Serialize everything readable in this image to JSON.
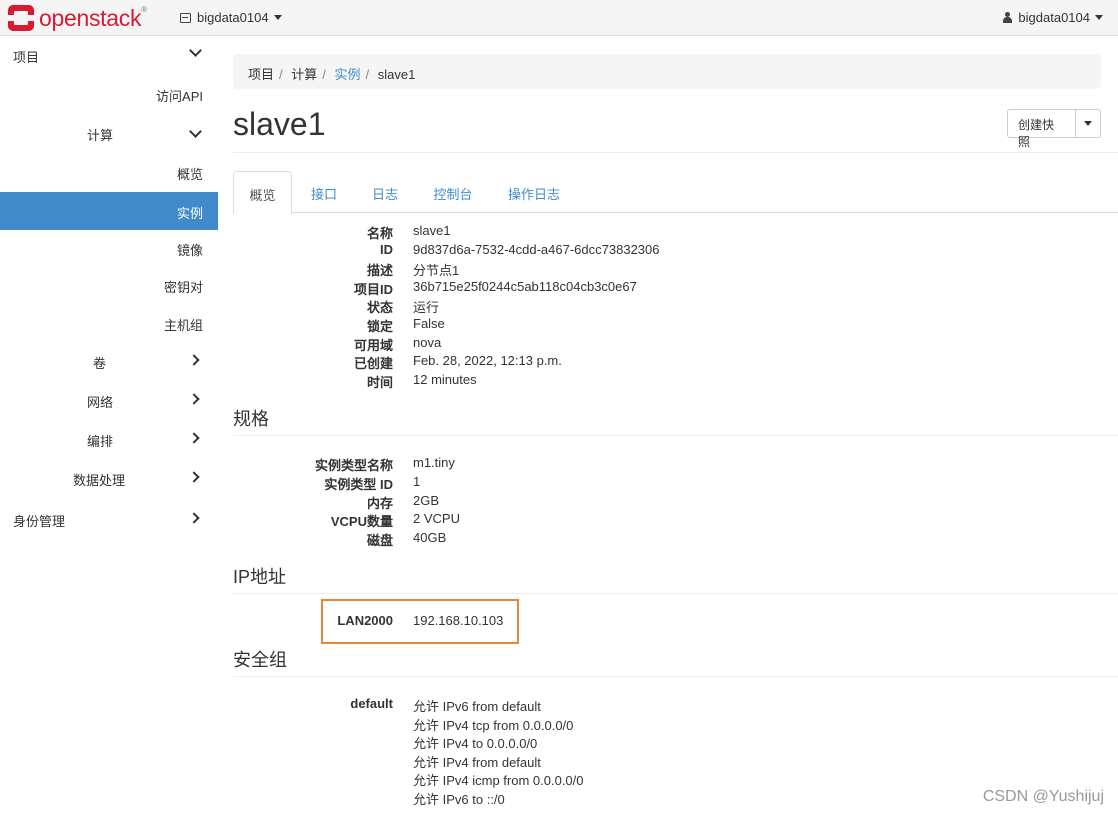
{
  "header": {
    "brand": "openstack",
    "brand_mark": "®",
    "project": "bigdata0104",
    "user": "bigdata0104"
  },
  "sidebar": {
    "project": "项目",
    "api_access": "访问API",
    "compute": "计算",
    "overview": "概览",
    "instances": "实例",
    "images": "镜像",
    "keypairs": "密钥对",
    "server_groups": "主机组",
    "volumes": "卷",
    "network": "网络",
    "orchestration": "编排",
    "data_processing": "数据处理",
    "identity": "身份管理"
  },
  "breadcrumb": [
    "项目",
    "计算",
    "实例",
    "slave1"
  ],
  "page": {
    "title": "slave1",
    "snapshot_button": "创建快照"
  },
  "tabs": [
    "概览",
    "接口",
    "日志",
    "控制台",
    "操作日志"
  ],
  "overview": [
    {
      "label": "名称",
      "value": "slave1"
    },
    {
      "label": "ID",
      "value": "9d837d6a-7532-4cdd-a467-6dcc73832306"
    },
    {
      "label": "描述",
      "value": "分节点1"
    },
    {
      "label": "项目ID",
      "value": "36b715e25f0244c5ab118c04cb3c0e67"
    },
    {
      "label": "状态",
      "value": "运行"
    },
    {
      "label": "锁定",
      "value": "False"
    },
    {
      "label": "可用域",
      "value": "nova"
    },
    {
      "label": "已创建",
      "value": "Feb. 28, 2022, 12:13 p.m."
    },
    {
      "label": "时间",
      "value": "12 minutes"
    }
  ],
  "specs": {
    "heading": "规格",
    "rows": [
      {
        "label": "实例类型名称",
        "value": "m1.tiny"
      },
      {
        "label": "实例类型 ID",
        "value": "1"
      },
      {
        "label": "内存",
        "value": "2GB"
      },
      {
        "label": "VCPU数量",
        "value": "2 VCPU"
      },
      {
        "label": "磁盘",
        "value": "40GB"
      }
    ]
  },
  "ip": {
    "heading": "IP地址",
    "rows": [
      {
        "label": "LAN2000",
        "value": "192.168.10.103"
      }
    ]
  },
  "security": {
    "heading": "安全组",
    "group": "default",
    "rules": [
      "允许 IPv6 from default",
      "允许 IPv4 tcp from 0.0.0.0/0",
      "允许 IPv4 to 0.0.0.0/0",
      "允许 IPv4 from default",
      "允许 IPv4 icmp from 0.0.0.0/0",
      "允许 IPv6 to ::/0"
    ]
  },
  "watermark": "CSDN @Yushijuj",
  "colors": {
    "brand_red": "#da1a32",
    "link_blue": "#428bca",
    "active_nav": "#428bca",
    "highlight_orange": "#e8873a"
  }
}
